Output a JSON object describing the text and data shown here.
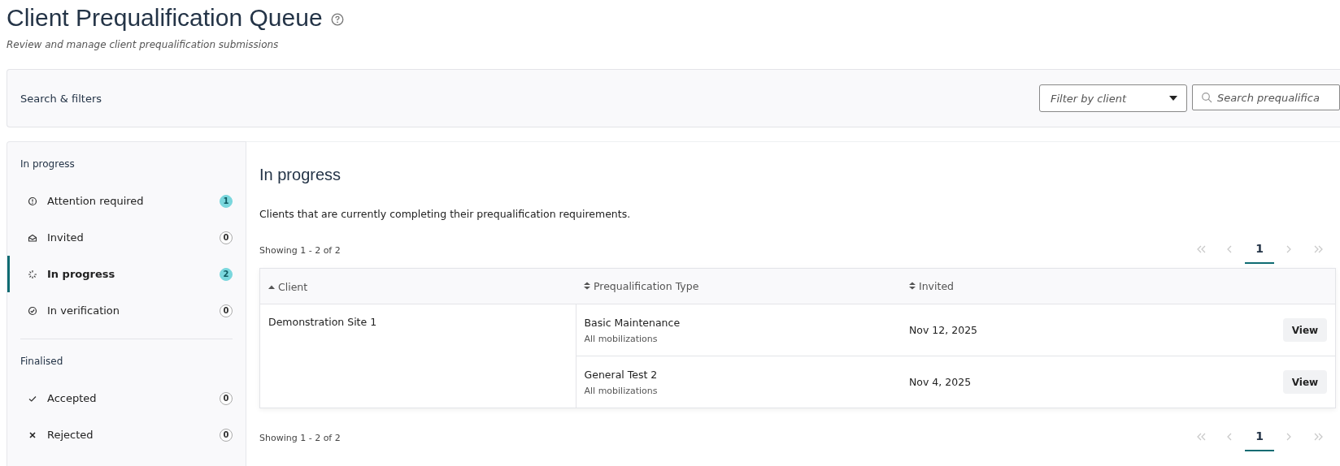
{
  "page": {
    "title": "Client Prequalification Queue",
    "subtitle": "Review and manage client prequalification submissions"
  },
  "filters": {
    "label": "Search & filters",
    "client_select": {
      "placeholder": "Filter by client"
    },
    "search": {
      "placeholder": "Search prequalifica"
    }
  },
  "sidebar": {
    "groups": [
      {
        "heading": "In progress",
        "items": [
          {
            "kind": "attention",
            "label": "Attention required",
            "count": "1",
            "highlighted": true,
            "selected": false
          },
          {
            "kind": "invited",
            "label": "Invited",
            "count": "0",
            "highlighted": false,
            "selected": false
          },
          {
            "kind": "progress",
            "label": "In progress",
            "count": "2",
            "highlighted": true,
            "selected": true
          },
          {
            "kind": "verification",
            "label": "In verification",
            "count": "0",
            "highlighted": false,
            "selected": false
          }
        ]
      },
      {
        "heading": "Finalised",
        "items": [
          {
            "kind": "accepted",
            "label": "Accepted",
            "count": "0",
            "highlighted": false,
            "selected": false
          },
          {
            "kind": "rejected",
            "label": "Rejected",
            "count": "0",
            "highlighted": false,
            "selected": false
          }
        ]
      }
    ]
  },
  "main": {
    "heading": "In progress",
    "description": "Clients that are currently completing their prequalification requirements.",
    "showing_top": "Showing 1 - 2 of 2",
    "showing_bottom": "Showing 1 - 2 of 2",
    "pagination_top": [
      {
        "kind": "first",
        "disabled": true
      },
      {
        "kind": "prev",
        "disabled": true
      },
      {
        "kind": "page",
        "label": "1",
        "selected": true
      },
      {
        "kind": "next",
        "disabled": true
      },
      {
        "kind": "last",
        "disabled": true
      }
    ],
    "pagination_bottom": [
      {
        "kind": "first",
        "disabled": true
      },
      {
        "kind": "prev",
        "disabled": true
      },
      {
        "kind": "page",
        "label": "1",
        "selected": true
      },
      {
        "kind": "next",
        "disabled": true
      },
      {
        "kind": "last",
        "disabled": true
      }
    ],
    "table": {
      "columns": [
        {
          "label": "Client",
          "sorted": true
        },
        {
          "label": "Prequalification Type",
          "sorted": false
        },
        {
          "label": "Invited",
          "sorted": false
        }
      ],
      "rows": [
        {
          "client": "Demonstration Site 1",
          "entries": [
            {
              "type": "Basic Maintenance",
              "scope": "All mobilizations",
              "invited": "Nov 12, 2025",
              "action": "View"
            },
            {
              "type": "General Test 2",
              "scope": "All mobilizations",
              "invited": "Nov 4, 2025",
              "action": "View"
            }
          ]
        }
      ]
    }
  }
}
